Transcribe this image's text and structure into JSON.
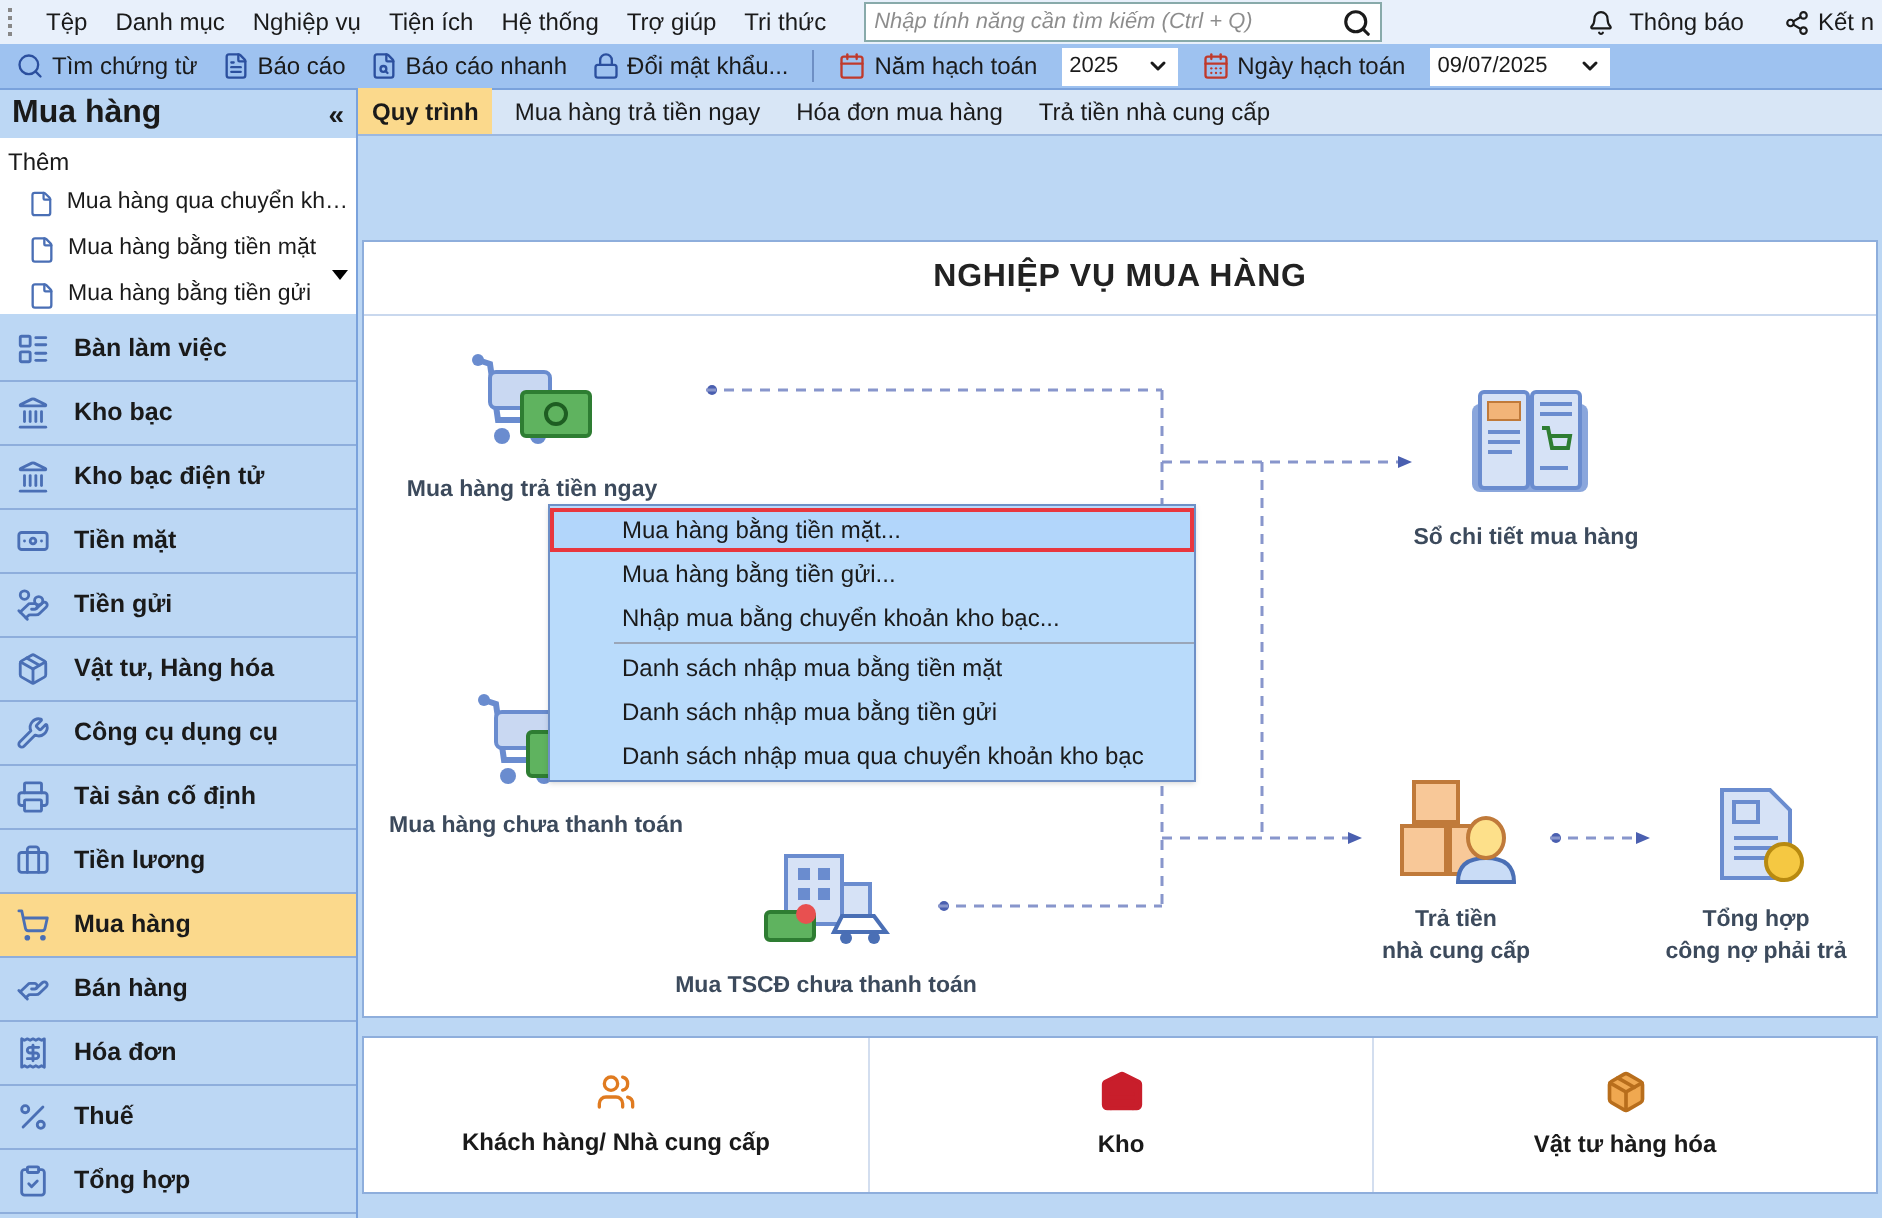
{
  "menu_bar": {
    "items": [
      "Tệp",
      "Danh mục",
      "Nghiệp vụ",
      "Tiện ích",
      "Hệ thống",
      "Trợ giúp",
      "Tri thức"
    ],
    "search": {
      "placeholder": "Nhập tính năng cần tìm kiếm (Ctrl + Q)"
    },
    "notifications": "Thông báo",
    "connect": "Kết n"
  },
  "toolbar": {
    "buttons": [
      "Tìm chứng từ",
      "Báo cáo",
      "Báo cáo nhanh",
      "Đổi mật khẩu..."
    ],
    "year_label": "Năm hạch toán",
    "year": "2025",
    "date_label": "Ngày hạch toán",
    "date": "09/07/2025"
  },
  "sidebar": {
    "title": "Mua hàng",
    "collapse": "«",
    "add": {
      "title": "Thêm",
      "items": [
        "Mua hàng qua chuyển kh…",
        "Mua hàng bằng tiền mặt",
        "Mua hàng bằng tiền gửi"
      ]
    },
    "items": [
      {
        "label": "Bàn làm việc",
        "selected": false
      },
      {
        "label": "Kho bạc",
        "selected": false
      },
      {
        "label": "Kho bạc điện tử",
        "selected": false
      },
      {
        "label": "Tiền mặt",
        "selected": false
      },
      {
        "label": "Tiền gửi",
        "selected": false
      },
      {
        "label": "Vật tư, Hàng hóa",
        "selected": false
      },
      {
        "label": "Công cụ dụng cụ",
        "selected": false
      },
      {
        "label": "Tài sản cố định",
        "selected": false
      },
      {
        "label": "Tiền lương",
        "selected": false
      },
      {
        "label": "Mua hàng",
        "selected": true
      },
      {
        "label": "Bán hàng",
        "selected": false
      },
      {
        "label": "Hóa đơn",
        "selected": false
      },
      {
        "label": "Thuế",
        "selected": false
      },
      {
        "label": "Tổng hợp",
        "selected": false
      }
    ]
  },
  "tabs": [
    {
      "label": "Quy trình",
      "selected": true
    },
    {
      "label": "Mua hàng trả tiền ngay",
      "selected": false
    },
    {
      "label": "Hóa đơn mua hàng",
      "selected": false
    },
    {
      "label": "Trả tiền nhà cung cấp",
      "selected": false
    }
  ],
  "diagram": {
    "title": "NGHIỆP VỤ MUA HÀNG",
    "nodes": [
      {
        "lines": [
          "Mua hàng trả tiền ngay"
        ]
      },
      {
        "lines": [
          "Mua hàng chưa thanh toán"
        ]
      },
      {
        "lines": [
          "Mua TSCĐ chưa thanh toán"
        ]
      },
      {
        "lines": [
          "Sổ chi tiết mua hàng"
        ]
      },
      {
        "lines": [
          "Trả tiền",
          "nhà cung cấp"
        ]
      },
      {
        "lines": [
          "Tổng hợp",
          "công nợ phải trả"
        ]
      }
    ]
  },
  "context_menu": {
    "groups": [
      [
        {
          "label": "Mua hàng bằng tiền mặt...",
          "selected": true
        },
        {
          "label": "Mua hàng bằng tiền gửi...",
          "selected": false
        },
        {
          "label": "Nhập mua bằng chuyển khoản kho bạc...",
          "selected": false
        }
      ],
      [
        {
          "label": "Danh sách nhập mua bằng tiền mặt",
          "selected": false
        },
        {
          "label": "Danh sách nhập mua bằng tiền gửi",
          "selected": false
        },
        {
          "label": "Danh sách nhập mua qua chuyển khoản kho bạc",
          "selected": false
        }
      ]
    ]
  },
  "shortcuts": [
    "Khách hàng/ Nhà cung cấp",
    "Kho",
    "Vật tư hàng hóa"
  ]
}
